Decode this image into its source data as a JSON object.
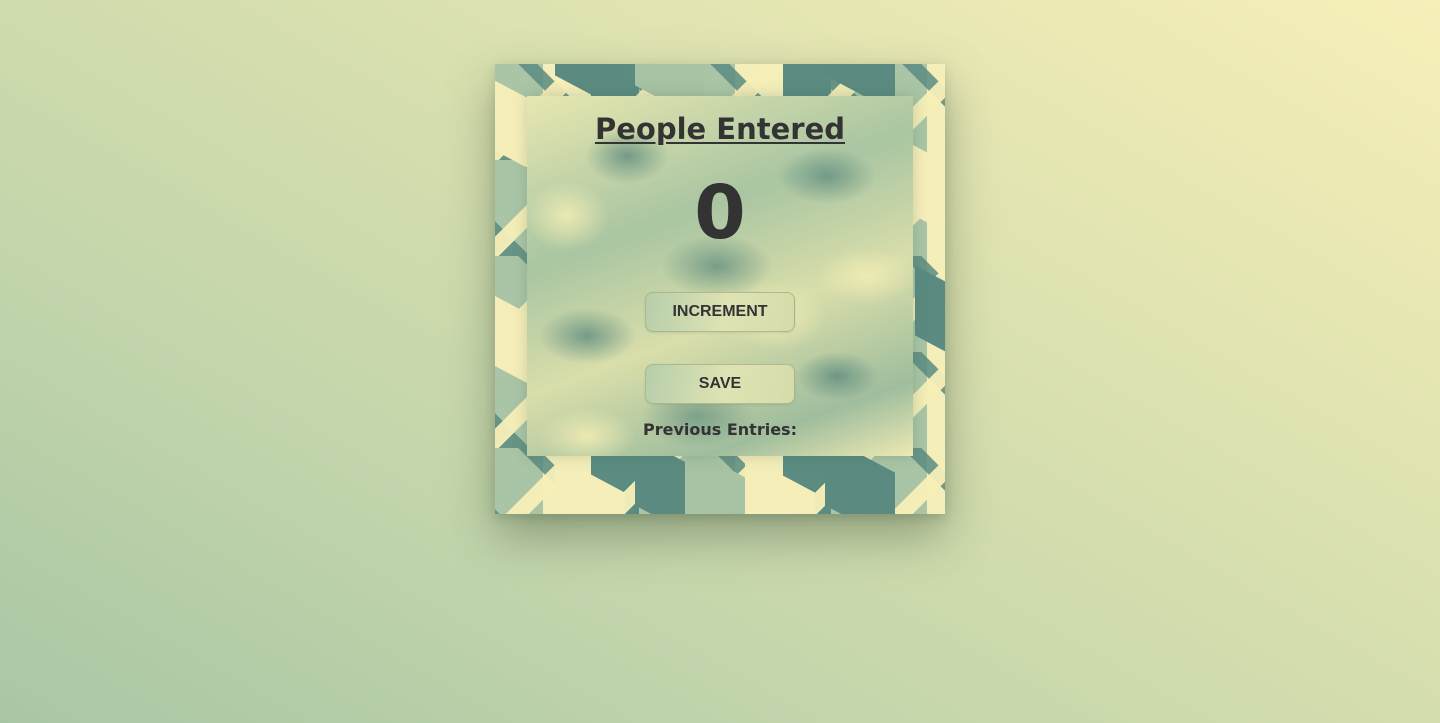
{
  "counter": {
    "title": "People Entered",
    "count": "0"
  },
  "buttons": {
    "increment_label": "INCREMENT",
    "save_label": "SAVE"
  },
  "history": {
    "label": "Previous Entries:",
    "entries": []
  },
  "colors": {
    "text": "#333333",
    "pattern_cream": "#f6eeb9",
    "pattern_teal": "#5b8b80",
    "pattern_sage": "#a9c5a6"
  }
}
